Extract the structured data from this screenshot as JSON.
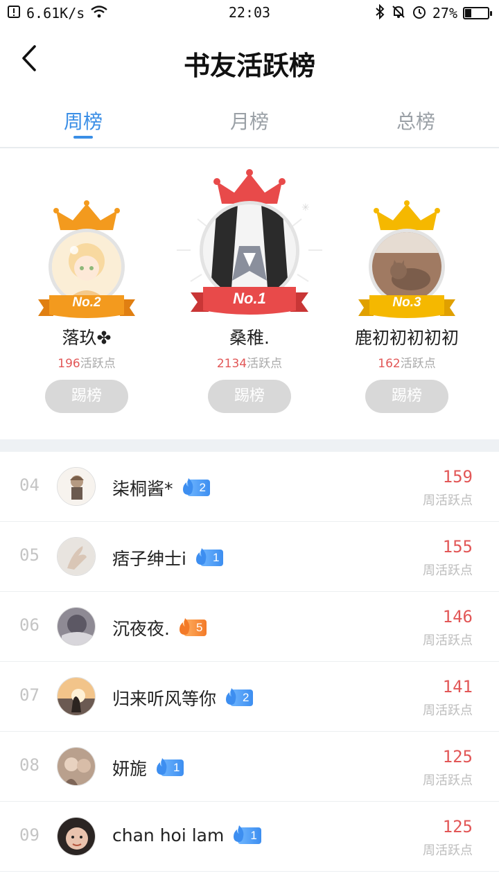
{
  "status_bar": {
    "speed": "6.61K/s",
    "time": "22:03",
    "battery": "27%",
    "battery_level": 0.27
  },
  "header": {
    "title": "书友活跃榜"
  },
  "tabs": [
    {
      "label": "周榜",
      "active": true
    },
    {
      "label": "月榜",
      "active": false
    },
    {
      "label": "总榜",
      "active": false
    }
  ],
  "podium": {
    "first": {
      "rank_label": "No.1",
      "name": "桑稚.",
      "points": "2134",
      "points_suffix": "活跃点",
      "button": "踢榜"
    },
    "second": {
      "rank_label": "No.2",
      "name": "落玖✤",
      "points": "196",
      "points_suffix": "活跃点",
      "button": "踢榜"
    },
    "third": {
      "rank_label": "No.3",
      "name": "鹿初初初初初",
      "points": "162",
      "points_suffix": "活跃点",
      "button": "踢榜"
    }
  },
  "colors": {
    "accent": "#3a8ee6",
    "score": "#e25757",
    "gold": "#f5b800",
    "silver_orange": "#f39a1e",
    "first_red": "#e84a4a"
  },
  "list": [
    {
      "rank": "04",
      "name": "柒桐酱*",
      "badge": "2",
      "badge_color": "blue",
      "score": "159",
      "label": "周活跃点"
    },
    {
      "rank": "05",
      "name": "痞子绅士i",
      "badge": "1",
      "badge_color": "blue",
      "score": "155",
      "label": "周活跃点"
    },
    {
      "rank": "06",
      "name": "沉夜夜.",
      "badge": "5",
      "badge_color": "orange",
      "score": "146",
      "label": "周活跃点"
    },
    {
      "rank": "07",
      "name": "归来听风等你",
      "badge": "2",
      "badge_color": "blue",
      "score": "141",
      "label": "周活跃点"
    },
    {
      "rank": "08",
      "name": "妍旎",
      "badge": "1",
      "badge_color": "blue",
      "score": "125",
      "label": "周活跃点"
    },
    {
      "rank": "09",
      "name": "chan hoi lam",
      "badge": "1",
      "badge_color": "blue",
      "score": "125",
      "label": "周活跃点"
    }
  ]
}
